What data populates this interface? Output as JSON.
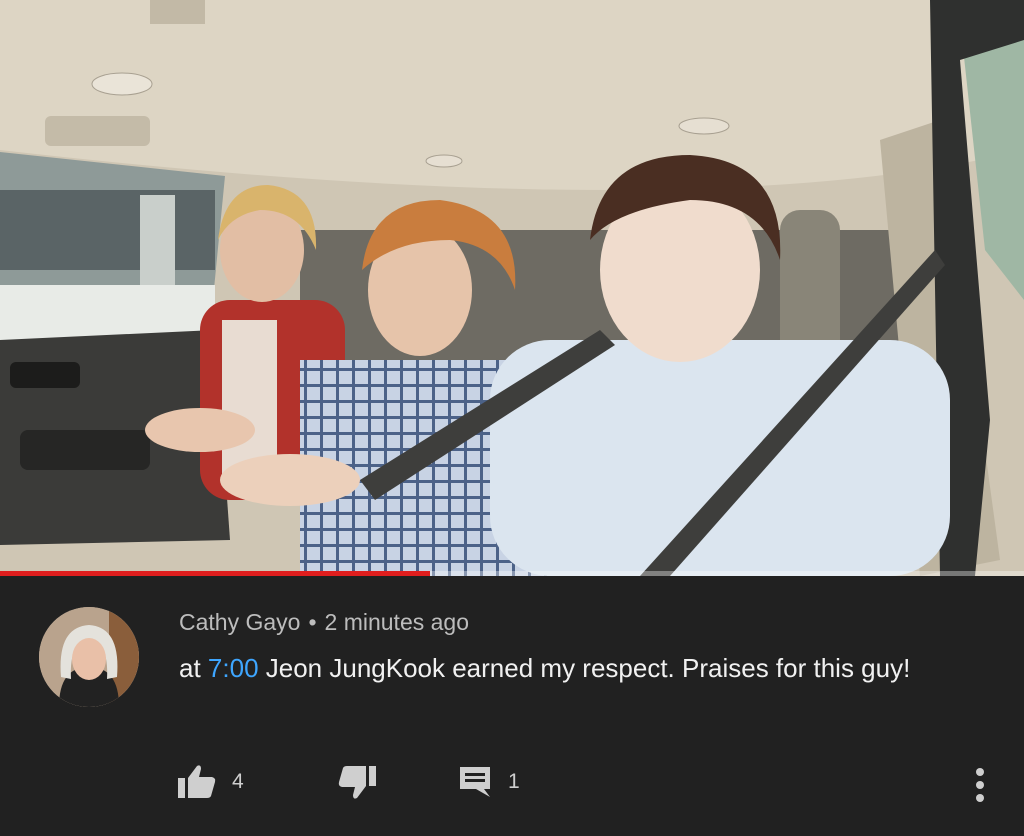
{
  "video": {
    "progress_fraction": 0.42
  },
  "comment": {
    "author": "Cathy Gayo",
    "separator": "•",
    "time": "2 minutes ago",
    "text_before": "at ",
    "timestamp": "7:00",
    "text_after": " Jeon JungKook earned my respect. Praises for this guy!",
    "likes": "4",
    "replies": "1"
  },
  "icons": {
    "like": "thumbs-up-icon",
    "dislike": "thumbs-down-icon",
    "reply": "comment-icon",
    "more": "more-vert-icon"
  },
  "colors": {
    "background": "#212121",
    "progress": "#e01e1e",
    "timestamp_link": "#3ea6ff",
    "meta_text": "#bdbdbd"
  }
}
